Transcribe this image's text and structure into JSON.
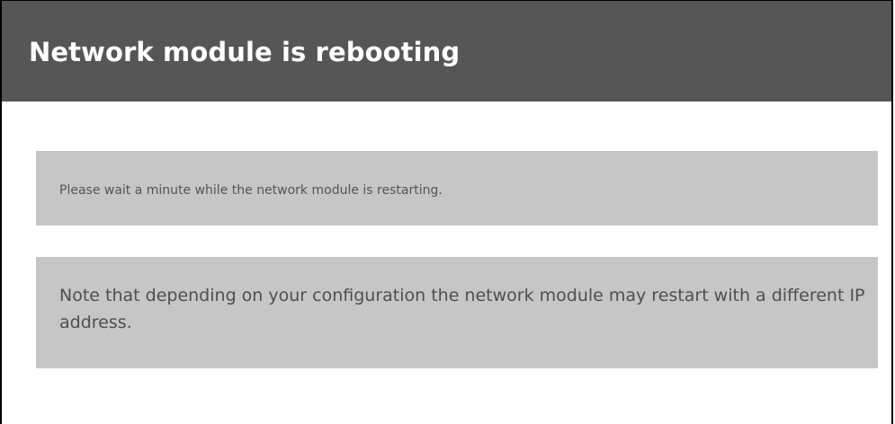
{
  "header": {
    "title": "Network module is rebooting",
    "background_color": "#565656",
    "text_color": "#ffffff"
  },
  "messages": {
    "wait_text": "Please wait a minute while the network module is restarting.",
    "note_text": "Note that depending on your configuration the network module may restart with a different IP address.",
    "panel_color": "#c6c6c6"
  }
}
